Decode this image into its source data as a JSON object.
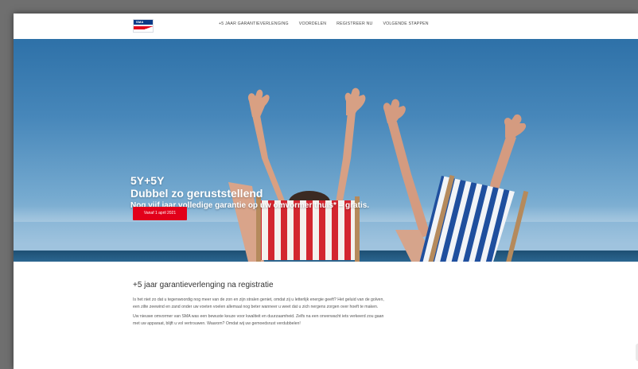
{
  "brand": {
    "logo_text": "SMA",
    "colors": {
      "blue": "#0b3a87",
      "red": "#e2001a"
    }
  },
  "nav": {
    "links": [
      "+5 JAAR GARANTIEVERLENGING",
      "VOORDELEN",
      "REGISTREER NU",
      "VOLGENDE STAPPEN"
    ]
  },
  "hero": {
    "heading_small": "5Y+5Y",
    "heading_big": "Dubbel zo geruststellend",
    "subheading": "Nog vijf jaar volledige garantie op uw omvormer thuis* – gratis.",
    "cta_label": "Vanaf 1 april 2021"
  },
  "content": {
    "title": "+5 jaar garantieverlenging na registratie",
    "paragraphs": [
      "Is het niet zo dat u tegenwoordig nog meer van de zon en zijn stralen geniet, omdat zij u letterlijk energie geeft? Het geluid van de golven, een zilte zeewind en zand onder uw voeten voelen allemaal nog beter wanneer u weet dat u zich nergens zorgen over hoeft te maken.",
      "Uw nieuwe omvormer van SMA was een bewuste keuze voor kwaliteit en duurzaamheid. Zelfs na een onverwacht iets verkeerd zou gaan met uw apparaat, blijft u vol vertrouwen. Waarom? Omdat wij uw gemoedsrust verdubbelen!"
    ]
  }
}
